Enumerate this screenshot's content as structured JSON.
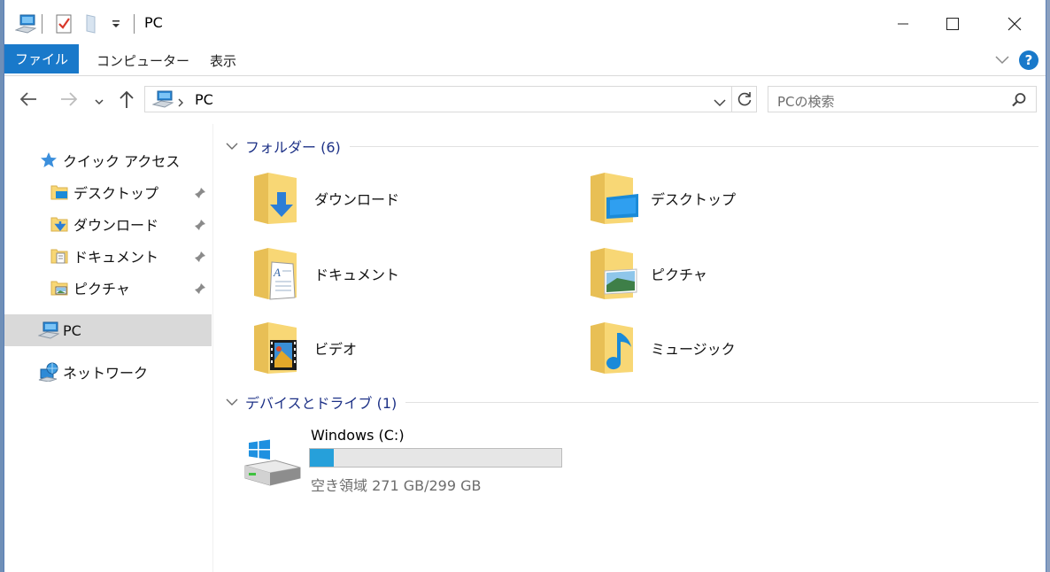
{
  "window": {
    "title": "PC"
  },
  "ribbon": {
    "file_tab": "ファイル",
    "tabs": [
      "コンピューター",
      "表示"
    ],
    "help": "?"
  },
  "address": {
    "path": "PC",
    "search_placeholder": "PCの検索"
  },
  "nav": {
    "quick_access": "クイック アクセス",
    "pinned": [
      "デスクトップ",
      "ダウンロード",
      "ドキュメント",
      "ピクチャ"
    ],
    "pc": "PC",
    "network": "ネットワーク"
  },
  "folders_group": {
    "label": "フォルダー (6)",
    "items": [
      "ダウンロード",
      "デスクトップ",
      "ドキュメント",
      "ピクチャ",
      "ビデオ",
      "ミュージック"
    ]
  },
  "devices_group": {
    "label": "デバイスとドライブ (1)"
  },
  "drive": {
    "name": "Windows (C:)",
    "used_fraction": 0.094,
    "free_text": "空き領域 271 GB/299 GB"
  },
  "colors": {
    "accent": "#1979ca",
    "drive_bar": "#26a0da",
    "group_header": "#1e3287",
    "folder": "#f8d775"
  }
}
